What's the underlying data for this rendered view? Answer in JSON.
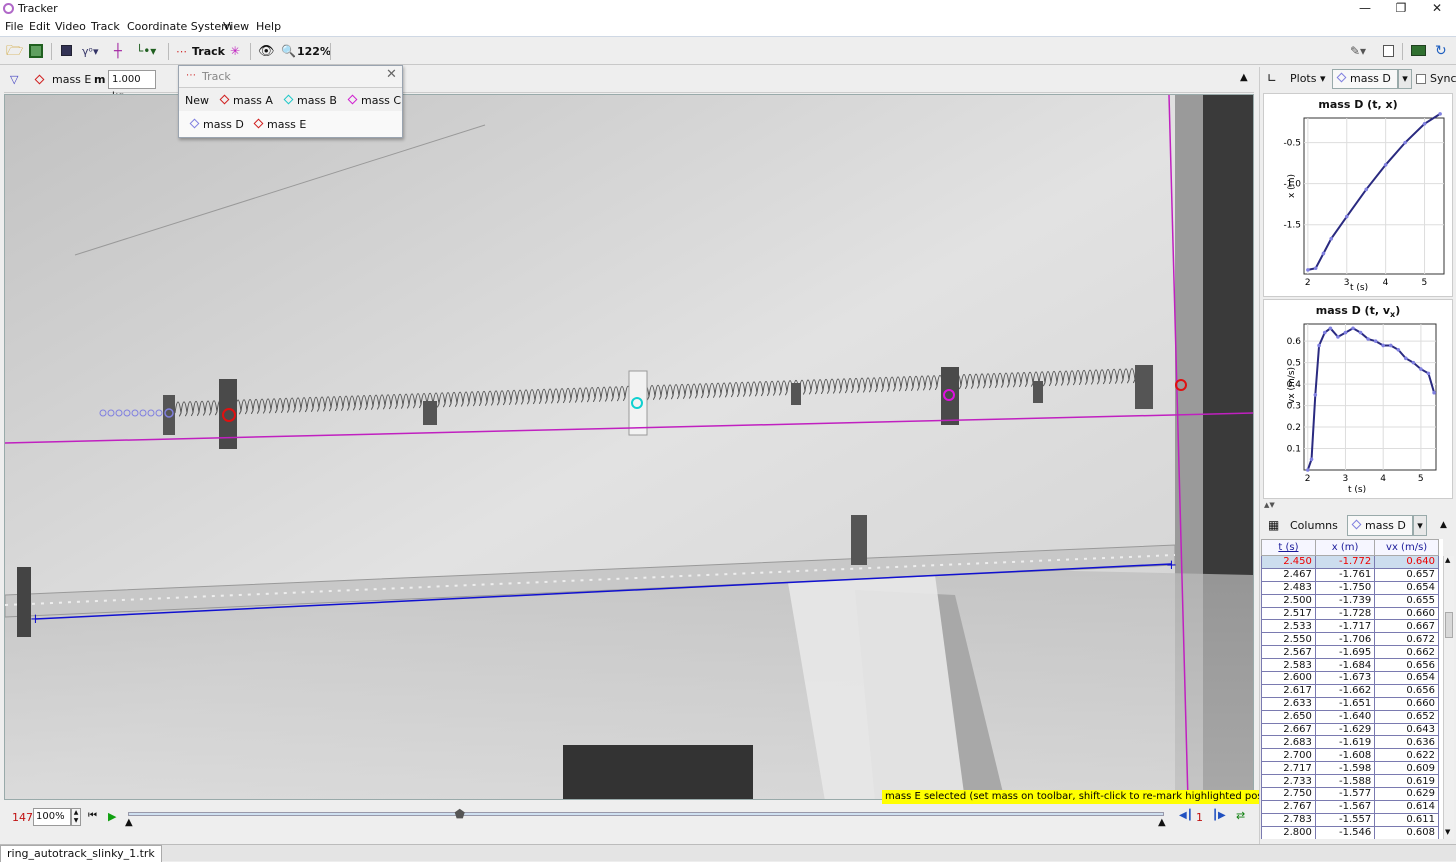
{
  "window": {
    "title": "Tracker"
  },
  "menu": [
    "File",
    "Edit",
    "Video",
    "Track",
    "Coordinate System",
    "View",
    "Help"
  ],
  "toolbar": {
    "track_label": "Track",
    "zoom_label": "122%"
  },
  "trackbar": {
    "track_name": "mass E",
    "mass_label": "m",
    "mass_value": "1.000 kg"
  },
  "popup": {
    "title": "Track",
    "new_label": "New",
    "items": [
      {
        "name": "mass A",
        "color": "#d02020"
      },
      {
        "name": "mass B",
        "color": "#20c8c8"
      },
      {
        "name": "mass C",
        "color": "#d020d0"
      },
      {
        "name": "mass D",
        "color": "#8080e0"
      },
      {
        "name": "mass E",
        "color": "#d02020"
      }
    ]
  },
  "status": {
    "message": "mass E selected (set mass on toolbar, shift-click to re-mark highlighted position)"
  },
  "player": {
    "frame": "147",
    "zoom": "100%",
    "step": "1",
    "slider_fraction": 0.32
  },
  "file_tab": {
    "name": "ring_autotrack_slinky_1.trk"
  },
  "plots_panel": {
    "plots_button": "Plots",
    "track_selector": "mass D",
    "sync_label": "Sync",
    "plot1": {
      "title": "mass D (t, x)",
      "ylabel": "x (m)",
      "xlabel": "t (s)",
      "xticks": [
        "2",
        "3",
        "4",
        "5"
      ],
      "yticks": [
        "-0.5",
        "-1.0",
        "-1.5"
      ]
    },
    "plot2": {
      "title": "mass D (t, v",
      "title_sub": "x",
      "title_end": ")",
      "ylabel": "vx (m/s)",
      "xlabel": "t (s)",
      "xticks": [
        "2",
        "3",
        "4",
        "5"
      ],
      "yticks": [
        "0.6",
        "0.5",
        "0.4",
        "0.3",
        "0.2",
        "0.1"
      ]
    }
  },
  "chart_data": [
    {
      "type": "line",
      "title": "mass D (t, x)",
      "xlabel": "t (s)",
      "ylabel": "x (m)",
      "xlim": [
        1.9,
        5.5
      ],
      "ylim": [
        -2.1,
        -0.2
      ],
      "series": [
        {
          "x": [
            2.0,
            2.2,
            2.4,
            2.6,
            3.0,
            3.5,
            4.0,
            4.5,
            5.0,
            5.4
          ],
          "values": [
            -2.05,
            -2.03,
            -1.85,
            -1.67,
            -1.4,
            -1.07,
            -0.77,
            -0.5,
            -0.27,
            -0.15
          ]
        }
      ]
    },
    {
      "type": "line",
      "title": "mass D (t, vx)",
      "xlabel": "t (s)",
      "ylabel": "vx (m/s)",
      "xlim": [
        1.9,
        5.4
      ],
      "ylim": [
        0,
        0.68
      ],
      "series": [
        {
          "x": [
            2.0,
            2.1,
            2.2,
            2.3,
            2.45,
            2.6,
            2.8,
            3.0,
            3.2,
            3.4,
            3.6,
            3.8,
            4.0,
            4.2,
            4.4,
            4.6,
            4.8,
            5.0,
            5.2,
            5.35
          ],
          "values": [
            0.0,
            0.05,
            0.35,
            0.58,
            0.64,
            0.66,
            0.62,
            0.64,
            0.66,
            0.64,
            0.61,
            0.6,
            0.58,
            0.58,
            0.56,
            0.52,
            0.5,
            0.47,
            0.45,
            0.36
          ]
        }
      ]
    }
  ],
  "data_table": {
    "columns_button": "Columns",
    "track_selector": "mass D",
    "headers": [
      "t (s)",
      "x (m)",
      "vx (m/s)"
    ],
    "rows": [
      [
        "2.450",
        "-1.772",
        "0.640"
      ],
      [
        "2.467",
        "-1.761",
        "0.657"
      ],
      [
        "2.483",
        "-1.750",
        "0.654"
      ],
      [
        "2.500",
        "-1.739",
        "0.655"
      ],
      [
        "2.517",
        "-1.728",
        "0.660"
      ],
      [
        "2.533",
        "-1.717",
        "0.667"
      ],
      [
        "2.550",
        "-1.706",
        "0.672"
      ],
      [
        "2.567",
        "-1.695",
        "0.662"
      ],
      [
        "2.583",
        "-1.684",
        "0.656"
      ],
      [
        "2.600",
        "-1.673",
        "0.654"
      ],
      [
        "2.617",
        "-1.662",
        "0.656"
      ],
      [
        "2.633",
        "-1.651",
        "0.660"
      ],
      [
        "2.650",
        "-1.640",
        "0.652"
      ],
      [
        "2.667",
        "-1.629",
        "0.643"
      ],
      [
        "2.683",
        "-1.619",
        "0.636"
      ],
      [
        "2.700",
        "-1.608",
        "0.622"
      ],
      [
        "2.717",
        "-1.598",
        "0.609"
      ],
      [
        "2.733",
        "-1.588",
        "0.619"
      ],
      [
        "2.750",
        "-1.577",
        "0.629"
      ],
      [
        "2.767",
        "-1.567",
        "0.614"
      ],
      [
        "2.783",
        "-1.557",
        "0.611"
      ],
      [
        "2.800",
        "-1.546",
        "0.608"
      ]
    ]
  }
}
